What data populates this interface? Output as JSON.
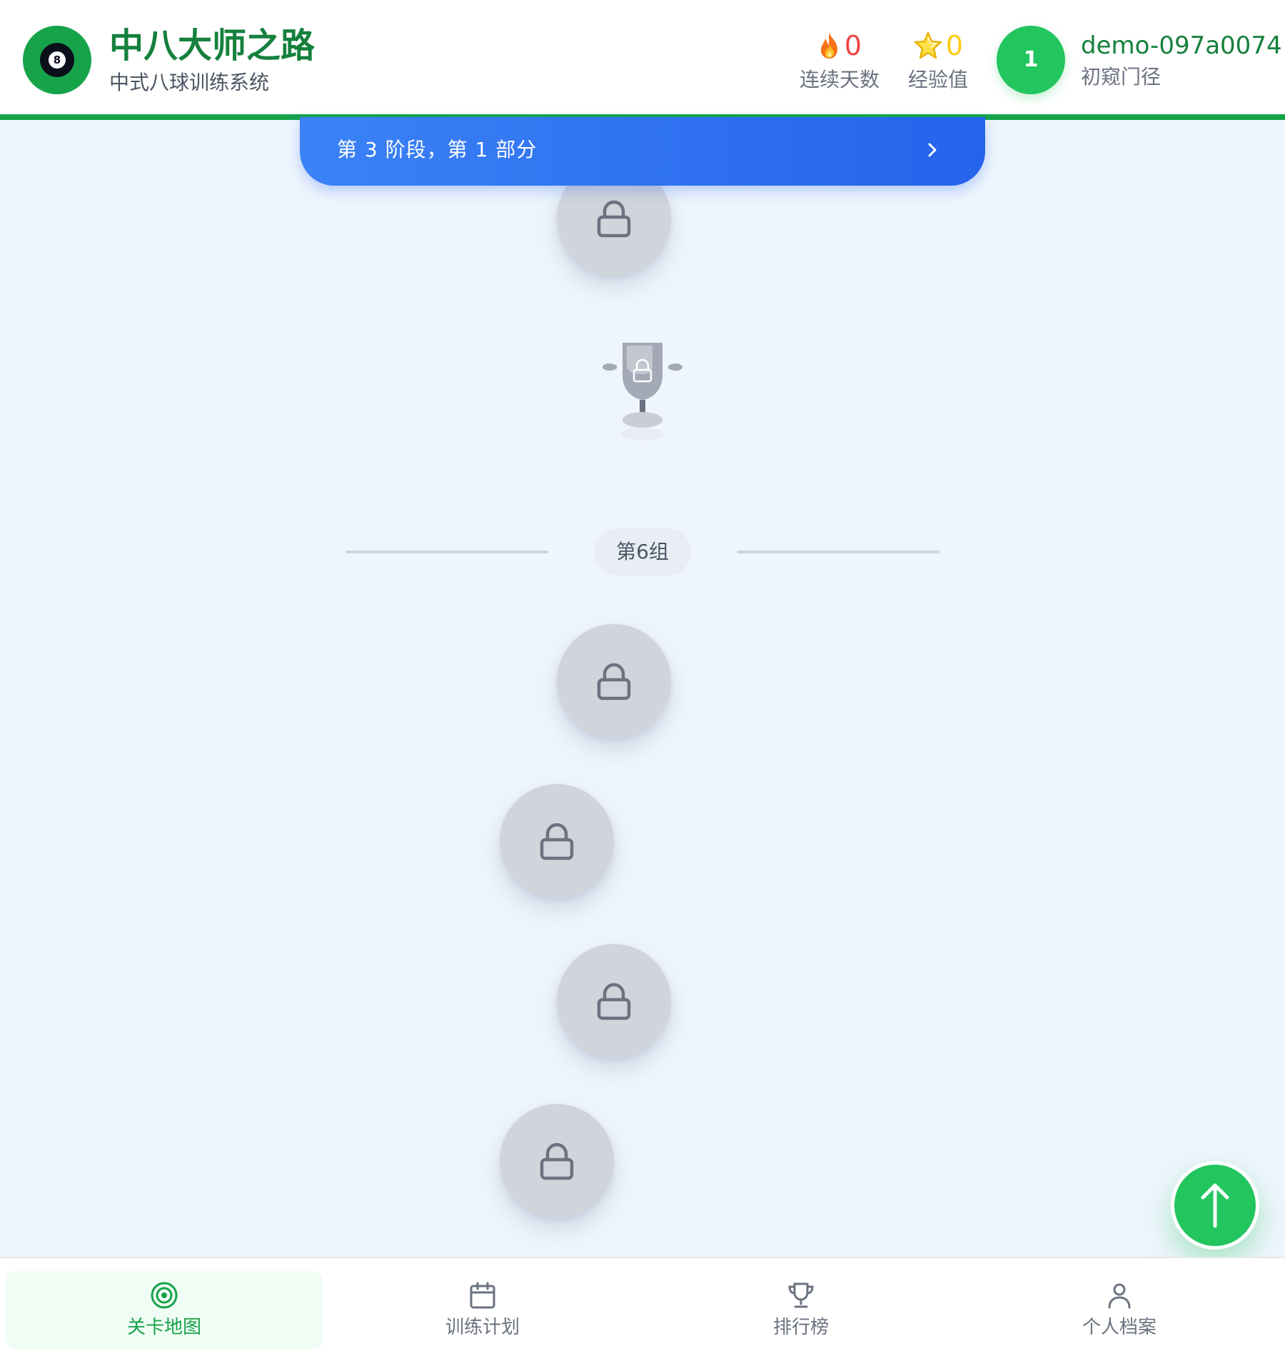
{
  "header": {
    "logo_ball_number": "8",
    "title": "中八大师之路",
    "subtitle": "中式八球训练系统",
    "stats": {
      "streak": {
        "icon": "fire-icon",
        "value": "0",
        "label": "连续天数"
      },
      "xp": {
        "icon": "star-icon",
        "value": "0",
        "label": "经验值"
      }
    },
    "user": {
      "level": "1",
      "name": "demo-097a0074",
      "rank": "初窥门径"
    }
  },
  "section_banner": {
    "text": "第 3 阶段，第 1 部分"
  },
  "path": {
    "group_label": "第6组",
    "nodes": [
      {
        "state": "locked",
        "icon": "lock-icon"
      },
      {
        "state": "locked",
        "icon": "lock-icon"
      },
      {
        "state": "locked",
        "icon": "lock-icon"
      },
      {
        "state": "locked",
        "icon": "lock-icon"
      },
      {
        "state": "locked",
        "icon": "lock-icon"
      }
    ],
    "trophy": {
      "state": "locked",
      "icon": "trophy-icon"
    }
  },
  "bottom_nav": {
    "items": [
      {
        "label": "关卡地图",
        "icon": "target-icon",
        "active": true
      },
      {
        "label": "训练计划",
        "icon": "calendar-icon",
        "active": false
      },
      {
        "label": "排行榜",
        "icon": "trophy-icon",
        "active": false
      },
      {
        "label": "个人档案",
        "icon": "user-icon",
        "active": false
      }
    ]
  },
  "colors": {
    "brand_green": "#16a34a",
    "title_green": "#15803d",
    "banner_blue": "#2563eb",
    "locked_node": "#d1d5db",
    "streak_red": "#ef4444",
    "xp_yellow": "#facc15",
    "background": "#eff5fd"
  }
}
